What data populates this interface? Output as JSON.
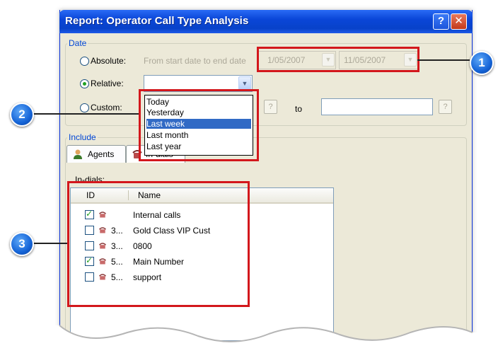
{
  "window": {
    "title": "Report: Operator Call Type Analysis",
    "help_label": "?",
    "close_label": "✕"
  },
  "date_group": {
    "label": "Date",
    "absolute": {
      "label": "Absolute:",
      "hint": "From start date to end date",
      "start": "1/05/2007",
      "end": "11/05/2007",
      "selected": false
    },
    "relative": {
      "label": "Relative:",
      "value": "",
      "selected": true
    },
    "custom": {
      "label": "Custom:",
      "q1": "?",
      "to": "to",
      "q2": "?",
      "selected": false
    }
  },
  "relative_options": [
    "Today",
    "Yesterday",
    "Last week",
    "Last month",
    "Last year"
  ],
  "relative_selected": "Last week",
  "include_group": {
    "label": "Include",
    "tabs": [
      {
        "label": "Agents",
        "icon": "agent-icon"
      },
      {
        "label": "In-dials",
        "icon": "phone-icon"
      }
    ]
  },
  "in_dials": {
    "label": "In-dials:",
    "columns": [
      "ID",
      "Name"
    ],
    "rows": [
      {
        "checked": true,
        "id": "",
        "name": "Internal calls"
      },
      {
        "checked": false,
        "id": "3...",
        "name": "Gold Class VIP Cust"
      },
      {
        "checked": false,
        "id": "3...",
        "name": "0800"
      },
      {
        "checked": true,
        "id": "5...",
        "name": "Main Number"
      },
      {
        "checked": false,
        "id": "5...",
        "name": "support"
      }
    ]
  },
  "callouts": [
    "1",
    "2",
    "3"
  ],
  "colors": {
    "title_bar": "#0a46d8",
    "callout_red": "#d3171c",
    "bubble_blue": "#1564d7",
    "selection": "#316ac5"
  }
}
